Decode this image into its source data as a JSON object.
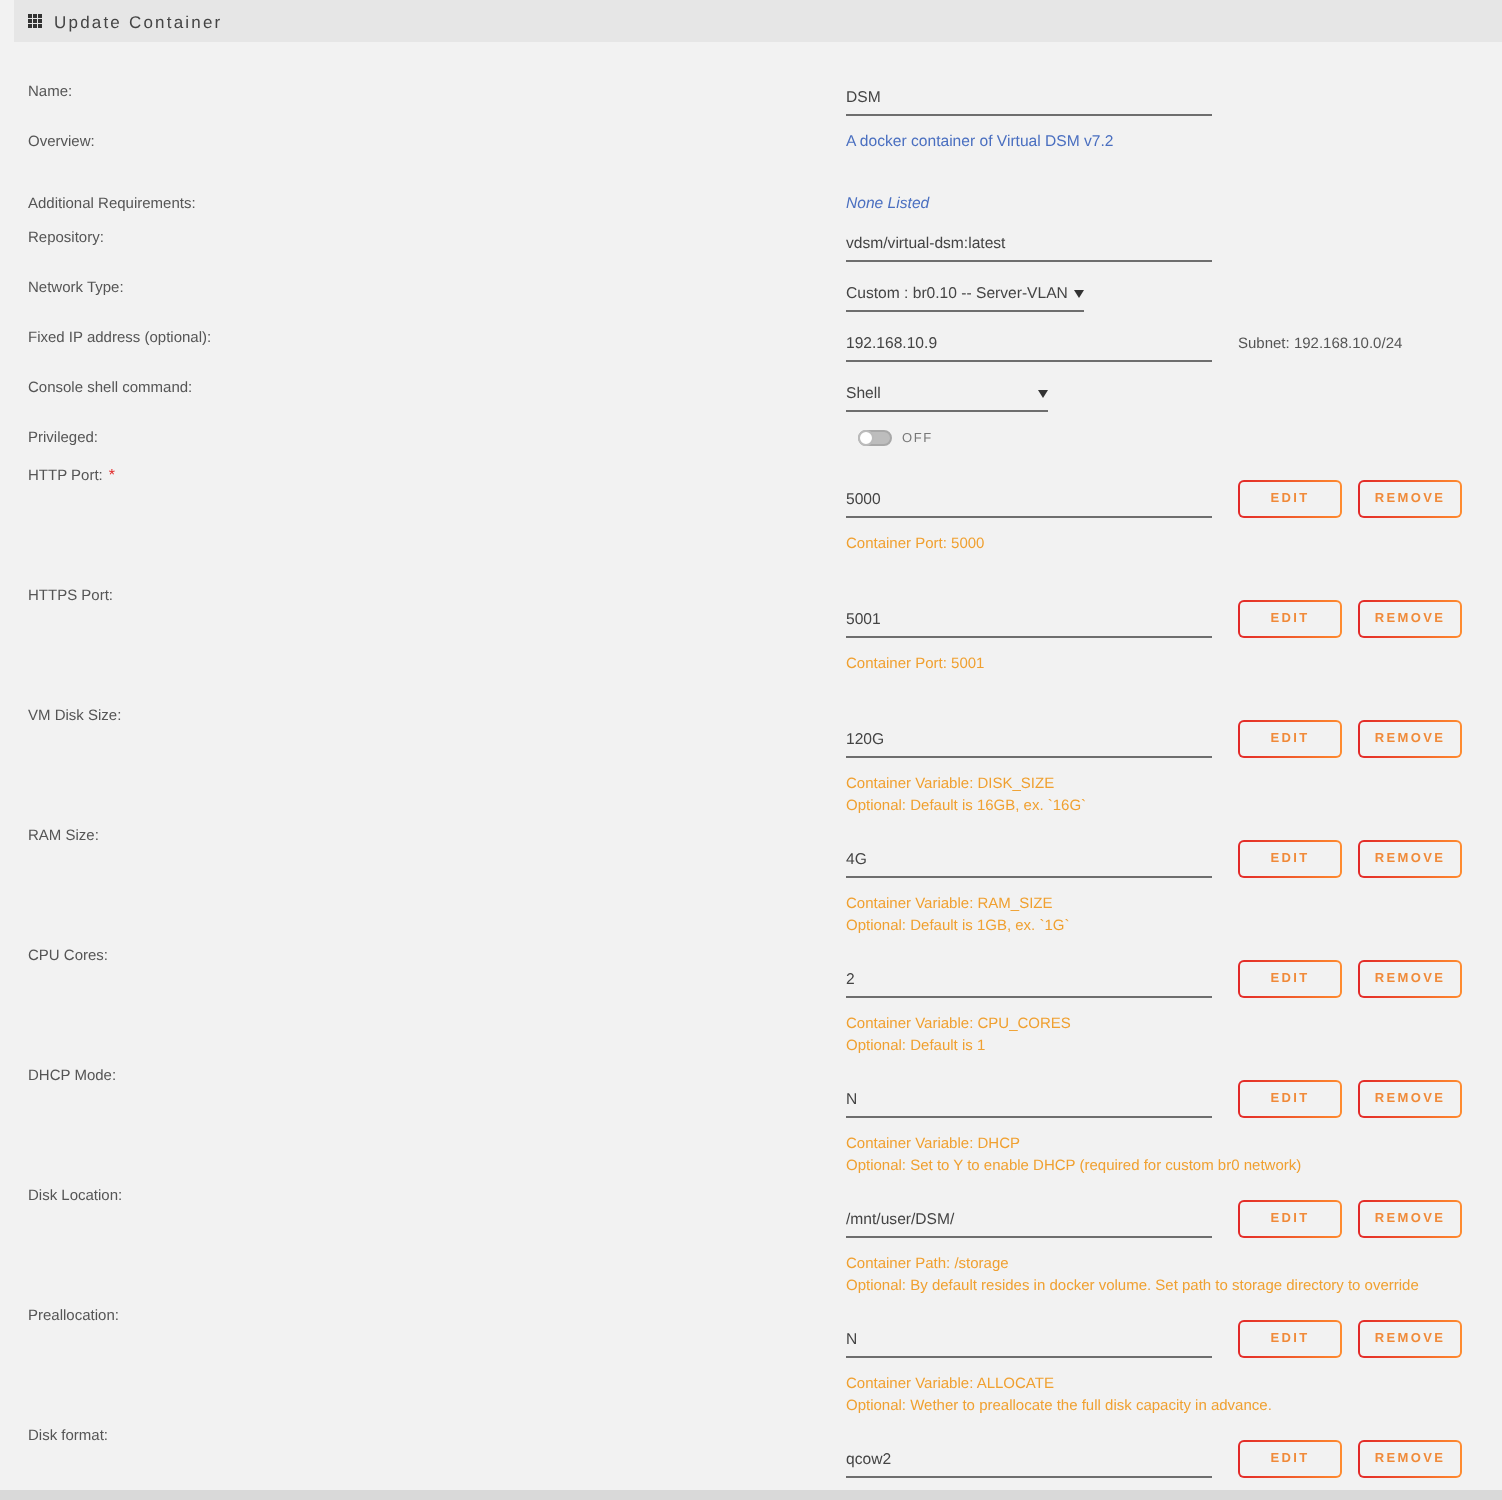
{
  "header": {
    "title": "Update Container"
  },
  "fields": [
    {
      "kind": "input",
      "label": "Name:",
      "value": "DSM"
    },
    {
      "kind": "text",
      "label": "Overview:",
      "value": "A docker container of Virtual DSM v7.2"
    },
    {
      "kind": "note",
      "label": "Additional Requirements:",
      "value": "None Listed"
    },
    {
      "kind": "input",
      "label": "Repository:",
      "value": "vdsm/virtual-dsm:latest"
    },
    {
      "kind": "select",
      "label": "Network Type:",
      "value": "Custom : br0.10 -- Server-VLAN"
    },
    {
      "kind": "input",
      "label": "Fixed IP address (optional):",
      "value": "192.168.10.9",
      "note": "Subnet: 192.168.10.0/24"
    },
    {
      "kind": "select",
      "label": "Console shell command:",
      "value": "Shell"
    },
    {
      "kind": "switch",
      "label": "Privileged:",
      "on": false,
      "state_label": "OFF"
    }
  ],
  "config": [
    {
      "label": "HTTP Port:",
      "required_mark": "*",
      "value": "5000",
      "edit": "EDIT",
      "remove": "REMOVE",
      "description": [
        "Container Port: 5000"
      ]
    },
    {
      "label": "HTTPS Port:",
      "value": "5001",
      "edit": "EDIT",
      "remove": "REMOVE",
      "description": [
        "Container Port: 5001"
      ]
    },
    {
      "label": "VM Disk Size:",
      "value": "120G",
      "edit": "EDIT",
      "remove": "REMOVE",
      "description": [
        "Container Variable: DISK_SIZE",
        "Optional: Default is 16GB, ex. `16G`"
      ]
    },
    {
      "label": "RAM Size:",
      "value": "4G",
      "edit": "EDIT",
      "remove": "REMOVE",
      "description": [
        "Container Variable: RAM_SIZE",
        "Optional: Default is 1GB, ex. `1G`"
      ]
    },
    {
      "label": "CPU Cores:",
      "value": "2",
      "edit": "EDIT",
      "remove": "REMOVE",
      "description": [
        "Container Variable: CPU_CORES",
        "Optional: Default is 1"
      ]
    },
    {
      "label": "DHCP Mode:",
      "value": "N",
      "edit": "EDIT",
      "remove": "REMOVE",
      "description": [
        "Container Variable: DHCP",
        "Optional: Set to Y to enable DHCP (required for custom br0 network)"
      ]
    },
    {
      "label": "Disk Location:",
      "value": "/mnt/user/DSM/",
      "edit": "EDIT",
      "remove": "REMOVE",
      "description": [
        "Container Path: /storage",
        "Optional: By default resides in docker volume. Set path to storage directory to override"
      ]
    },
    {
      "label": "Preallocation:",
      "value": "N",
      "edit": "EDIT",
      "remove": "REMOVE",
      "description": [
        "Container Variable: ALLOCATE",
        "Optional: Wether to preallocate the full disk capacity in advance."
      ]
    },
    {
      "label": "Disk format:",
      "value": "qcow2",
      "edit": "EDIT",
      "remove": "REMOVE"
    }
  ]
}
